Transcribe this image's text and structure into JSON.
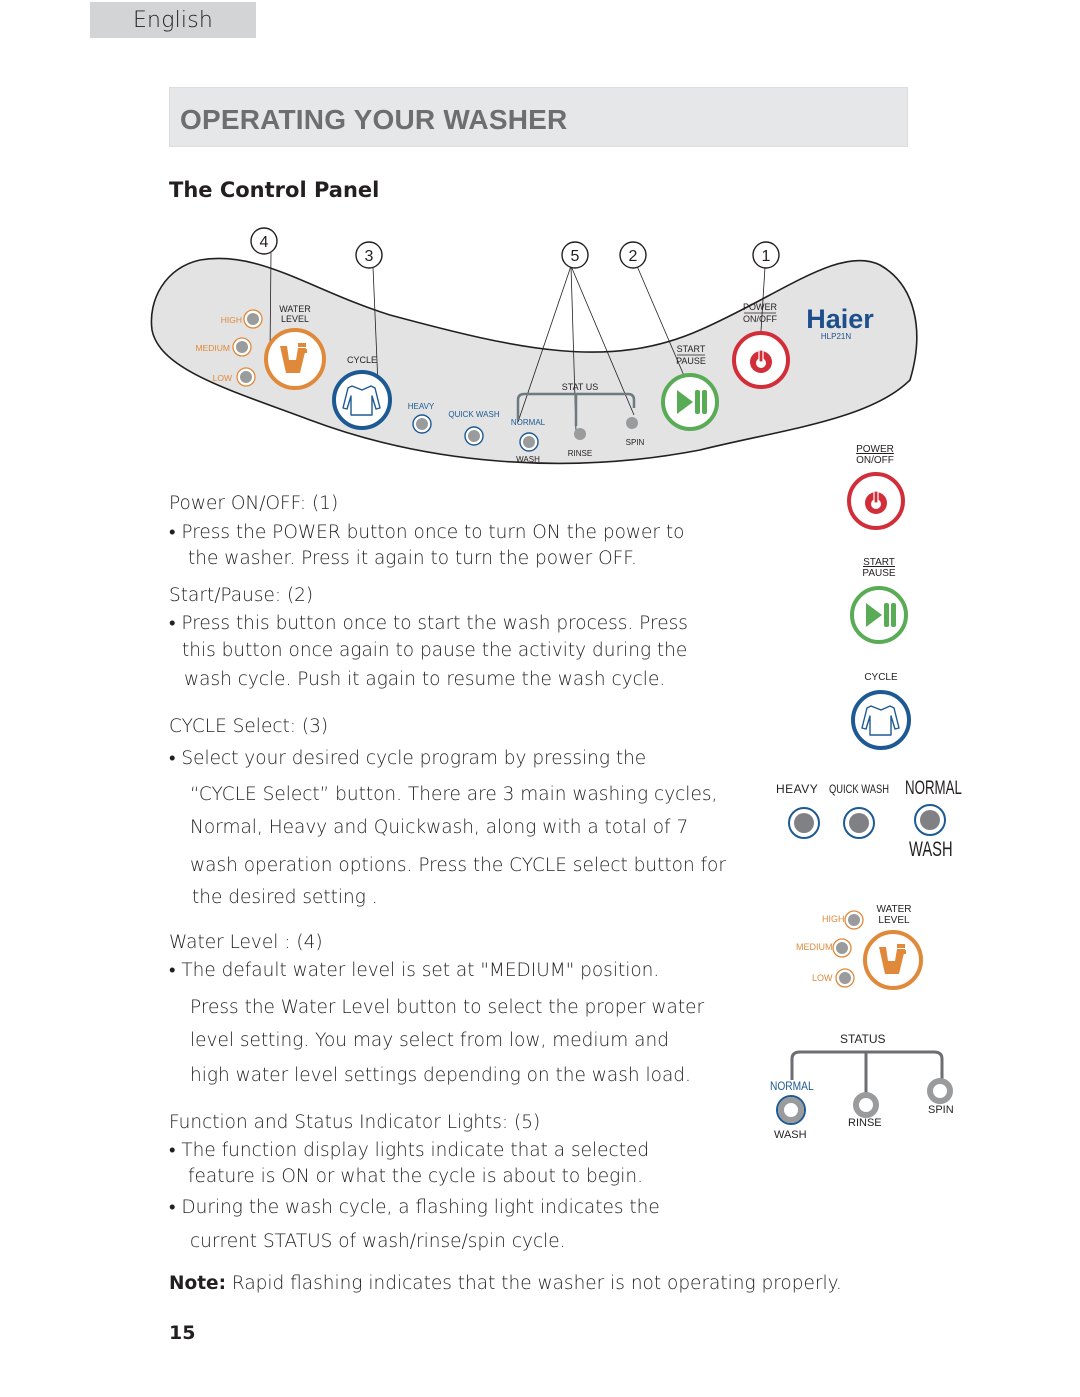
{
  "header": {
    "language_tab": "English",
    "section_title": "OPERATING YOUR WASHER",
    "subheading": "The Control Panel"
  },
  "colors": {
    "water_level_orange": "#e0893a",
    "cycle_blue": "#1d5a93",
    "start_green": "#5aab55",
    "power_red": "#d22e3a",
    "indicator_gray": "#9a9b9d",
    "panel_fill": "#e3e3e3",
    "brand_blue": "#1d4f8c"
  },
  "panel": {
    "callouts": [
      "4",
      "3",
      "5",
      "2",
      "1"
    ],
    "water_level": {
      "title_line1": "WATER",
      "title_line2": "LEVEL",
      "options": [
        "HIGH",
        "MEDIUM",
        "LOW"
      ]
    },
    "cycle": {
      "label": "CYCLE",
      "options": [
        "HEAVY",
        "QUICK WASH",
        "NORMAL"
      ]
    },
    "status": {
      "label": "STAT US",
      "stages": [
        "WASH",
        "RINSE",
        "SPIN"
      ]
    },
    "start_pause": {
      "line1": "START",
      "line2": "PAUSE"
    },
    "power": {
      "line1": "POWER",
      "line2": "ON/OFF"
    },
    "brand": {
      "name": "Haier",
      "model": "HLP21N"
    }
  },
  "sidebar": {
    "power": {
      "line1": "POWER",
      "line2": "ON/OFF"
    },
    "start_pause": {
      "line1": "START",
      "line2": "PAUSE"
    },
    "cycle_label": "CYCLE",
    "cycle_options": {
      "heavy": "HEAVY",
      "quick_wash": "QUICK WASH",
      "normal": "NORMAL",
      "wash": "WASH"
    },
    "water_level": {
      "title_line1": "WATER",
      "title_line2": "LEVEL",
      "options": [
        "HIGH",
        "MEDIUM",
        "LOW"
      ]
    },
    "status": {
      "label": "STATUS",
      "normal": "NORMAL",
      "stages": [
        "WASH",
        "RINSE",
        "SPIN"
      ]
    }
  },
  "sections": {
    "power": {
      "heading": "Power ON/OFF: (1)",
      "lines": [
        "• Press the POWER button once to turn ON the power to",
        "the washer. Press it again to turn the power OFF."
      ]
    },
    "start_pause": {
      "heading": "Start/Pause: (2)",
      "lines": [
        "• Press this button once to start the wash process. Press",
        "this button once again to pause the activity during the",
        "wash cycle. Push it  again to resume the wash cycle."
      ]
    },
    "cycle": {
      "heading": "CYCLE Select: (3)",
      "lines": [
        "• Select your desired cycle program by pressing the",
        "“CYCLE Select” button. There are 3 main washing cycles,",
        "Normal, Heavy and  Quickwash, along with a total of 7",
        "wash operation options. Press the CYCLE select button for",
        "the  desired  setting ."
      ]
    },
    "water_level": {
      "heading": "Water Level : (4)",
      "lines": [
        "• The default water level  is set at \"MEDIUM\" position.",
        "Press the Water Level  button  to select the proper water",
        "level setting.  You  may select from low, medium  and",
        "high water level settings  depending on the wash load."
      ]
    },
    "indicators": {
      "heading": "Function and Status Indicator Lights: (5)",
      "lines": [
        "• The function display lights indicate that a selected",
        "feature is ON or what the cycle is about to begin.",
        "• During the wash cycle, a flashing light indicates the",
        "current STATUS of  wash/rinse/spin cycle."
      ]
    }
  },
  "note": {
    "label": "Note:",
    "text": " Rapid flashing indicates that the washer is not operating properly."
  },
  "footer": {
    "page_number": "15"
  }
}
